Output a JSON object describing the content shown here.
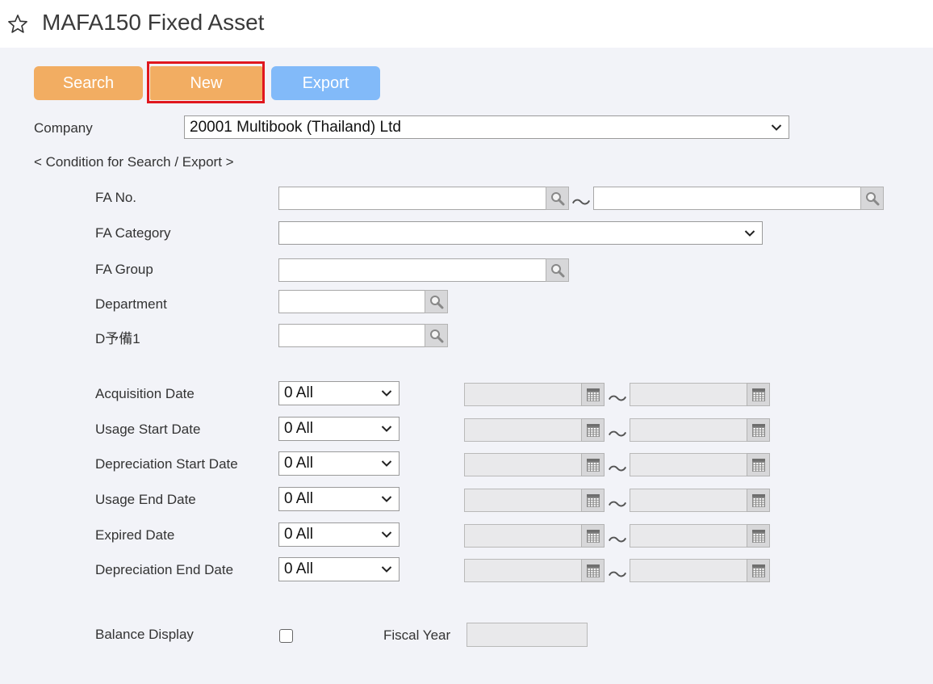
{
  "header": {
    "title": "MAFA150 Fixed Asset",
    "favorite_icon": "star-outline-icon"
  },
  "toolbar": {
    "search_label": "Search",
    "new_label": "New",
    "export_label": "Export"
  },
  "colors": {
    "primary_button": "#f2ad62",
    "export_button": "#82baf9",
    "highlight": "#e0171e",
    "background": "#f2f3f8"
  },
  "company": {
    "label": "Company",
    "value": "20001 Multibook (Thailand) Ltd"
  },
  "condition_heading": "< Condition for Search / Export >",
  "fields": {
    "fa_no": {
      "label": "FA No.",
      "range_sep": "～"
    },
    "fa_category": {
      "label": "FA Category",
      "value": ""
    },
    "fa_group": {
      "label": "FA Group"
    },
    "department": {
      "label": "Department"
    },
    "d_yobi1": {
      "label": "D予備1"
    }
  },
  "date_rows": [
    {
      "label": "Acquisition Date",
      "option": "0 All",
      "range_sep": "～"
    },
    {
      "label": "Usage Start Date",
      "option": "0 All",
      "range_sep": "～"
    },
    {
      "label": "Depreciation Start Date",
      "option": "0 All",
      "range_sep": "～"
    },
    {
      "label": "Usage End Date",
      "option": "0 All",
      "range_sep": "～"
    },
    {
      "label": "Expired Date",
      "option": "0 All",
      "range_sep": "～"
    },
    {
      "label": "Depreciation End Date",
      "option": "0 All",
      "range_sep": "～"
    }
  ],
  "balance": {
    "label": "Balance Display",
    "checked": false
  },
  "fiscal_year": {
    "label": "Fiscal Year",
    "value": ""
  }
}
